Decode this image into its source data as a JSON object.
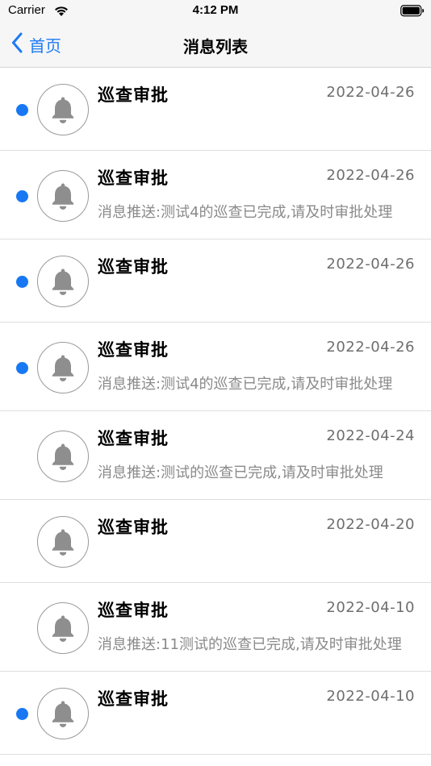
{
  "status_bar": {
    "carrier": "Carrier",
    "time": "4:12 PM"
  },
  "nav": {
    "back_label": "首页",
    "title": "消息列表"
  },
  "colors": {
    "accent": "#1d7bf5",
    "unread_dot": "#1878f3",
    "bell": "#8e8e8e"
  },
  "messages": [
    {
      "title": "巡查审批",
      "date": "2022-04-26",
      "preview": "",
      "unread": true
    },
    {
      "title": "巡查审批",
      "date": "2022-04-26",
      "preview": "消息推送:测试4的巡查已完成,请及时审批处理",
      "unread": true
    },
    {
      "title": "巡查审批",
      "date": "2022-04-26",
      "preview": "",
      "unread": true
    },
    {
      "title": "巡查审批",
      "date": "2022-04-26",
      "preview": "消息推送:测试4的巡查已完成,请及时审批处理",
      "unread": true
    },
    {
      "title": "巡查审批",
      "date": "2022-04-24",
      "preview": "消息推送:测试的巡查已完成,请及时审批处理",
      "unread": false
    },
    {
      "title": "巡查审批",
      "date": "2022-04-20",
      "preview": "",
      "unread": false
    },
    {
      "title": "巡查审批",
      "date": "2022-04-10",
      "preview": "消息推送:11测试的巡查已完成,请及时审批处理",
      "unread": false
    },
    {
      "title": "巡查审批",
      "date": "2022-04-10",
      "preview": "",
      "unread": true
    }
  ],
  "icons": {
    "back": "chevron-left-icon",
    "message": "bell-icon",
    "wifi": "wifi-icon",
    "battery": "battery-icon"
  }
}
